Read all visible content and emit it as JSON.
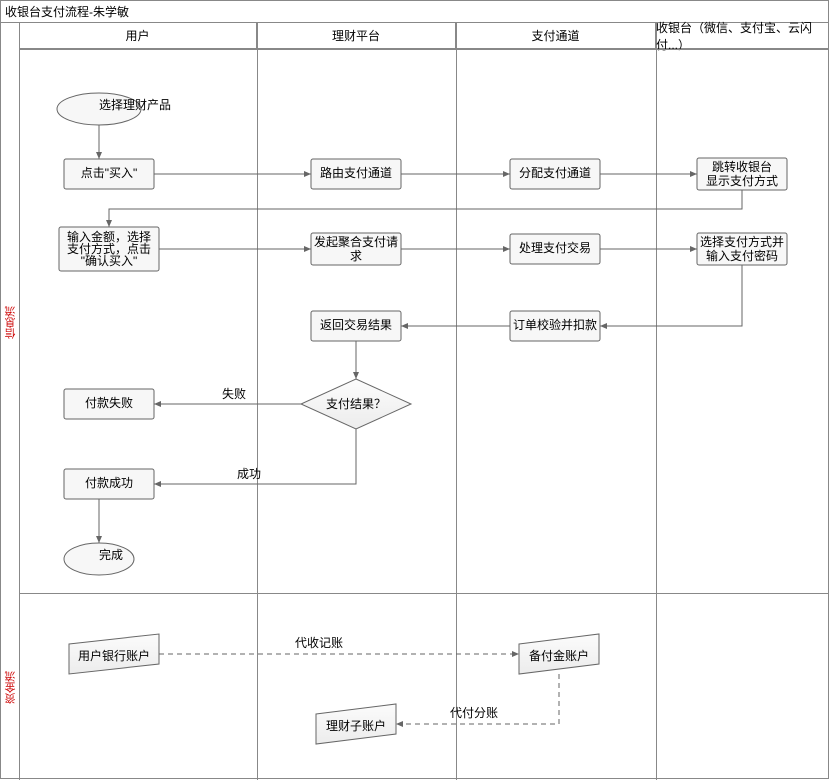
{
  "title": "收银台支付流程-朱学敏",
  "lanes": [
    "用户",
    "理财平台",
    "支付通道",
    "收银台（微信、支付宝、云闪付...）"
  ],
  "rows": [
    "信息流",
    "资金流"
  ],
  "nodes": {
    "select_prod": "选择理财产品",
    "click_buy": "点击\"买入\"",
    "route": "路由支付通道",
    "dispatch": "分配支付通道",
    "jump1": "跳转收银台",
    "jump2": "显示支付方式",
    "input1": "输入金额，选择",
    "input2": "支付方式，点击",
    "input3": "\"确认买入\"",
    "aggpay1": "发起聚合支付请",
    "aggpay2": "求",
    "process": "处理支付交易",
    "choose1": "选择支付方式并",
    "choose2": "输入支付密码",
    "verify": "订单校验并扣款",
    "result": "返回交易结果",
    "decision": "支付结果？",
    "fail": "付款失败",
    "success": "付款成功",
    "done": "完成",
    "edge_fail": "失败",
    "edge_success": "成功",
    "bank": "用户银行账户",
    "reserve": "备付金账户",
    "sub": "理财子账户",
    "edge_collect": "代收记账",
    "edge_payout": "代付分账"
  }
}
